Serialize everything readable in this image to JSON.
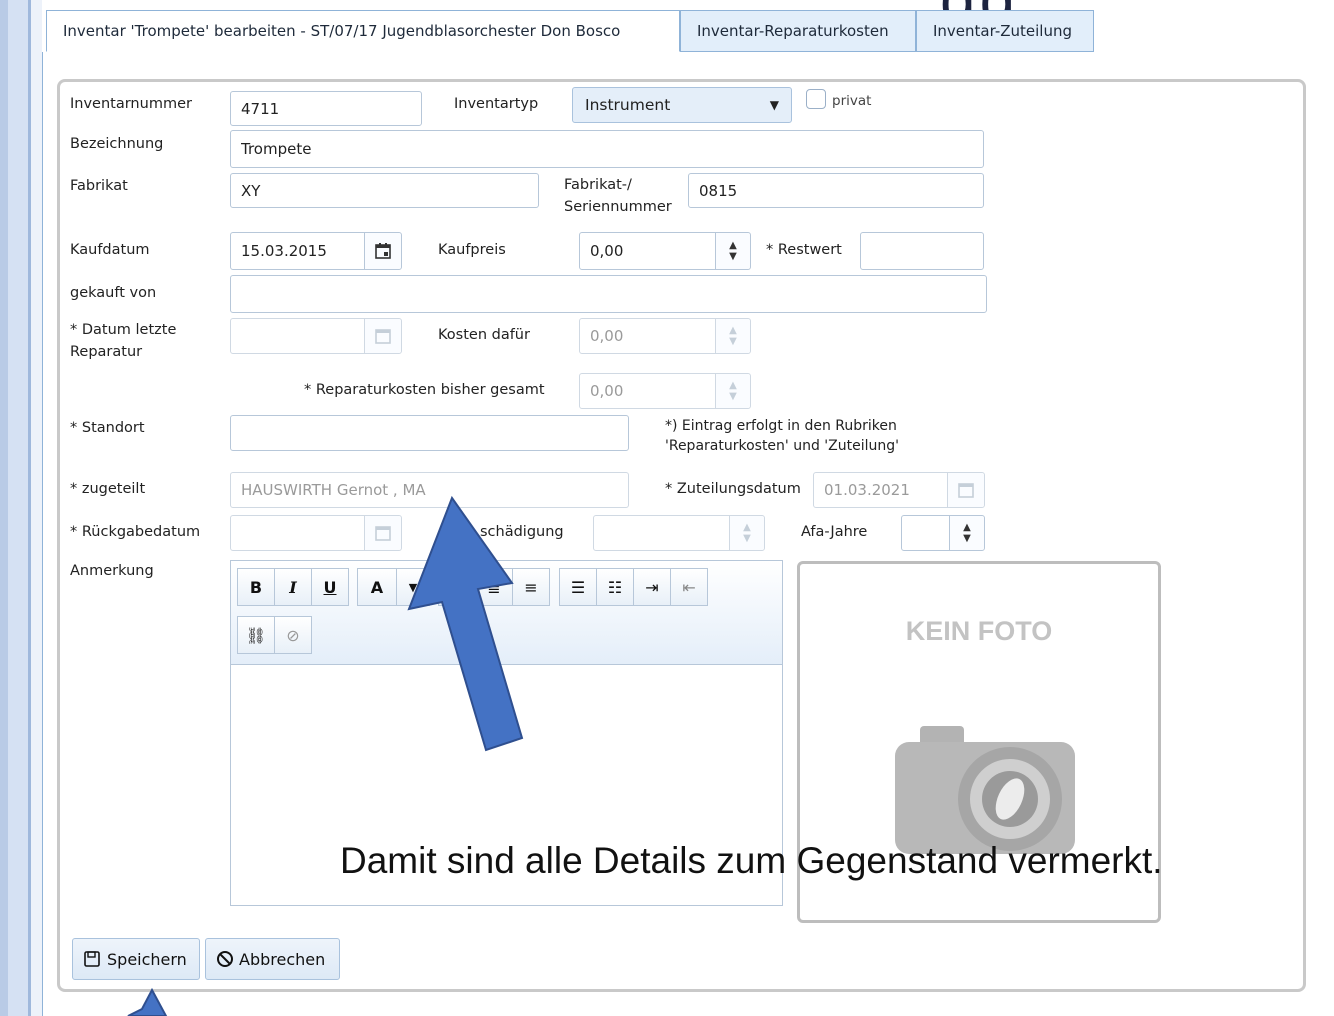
{
  "header_fragment": "gg",
  "tabs": [
    {
      "label": "Inventar 'Trompete' bearbeiten - ST/07/17 Jugendblasorchester Don Bosco",
      "active": true
    },
    {
      "label": "Inventar-Reparaturkosten",
      "active": false
    },
    {
      "label": "Inventar-Zuteilung",
      "active": false
    }
  ],
  "form": {
    "inventarnummer": {
      "label": "Inventarnummer",
      "value": "4711"
    },
    "inventartyp": {
      "label": "Inventartyp",
      "value": "Instrument"
    },
    "privat": {
      "label": "privat",
      "checked": false
    },
    "bezeichnung": {
      "label": "Bezeichnung",
      "value": "Trompete"
    },
    "fabrikat": {
      "label": "Fabrikat",
      "value": "XY"
    },
    "seriennummer": {
      "label_line1": "Fabrikat-/",
      "label_line2": "Seriennummer",
      "value": "0815"
    },
    "kaufdatum": {
      "label": "Kaufdatum",
      "value": "15.03.2015"
    },
    "kaufpreis": {
      "label": "Kaufpreis",
      "value": "0,00"
    },
    "restwert": {
      "label": "* Restwert",
      "value": ""
    },
    "gekauft_von": {
      "label": "gekauft von",
      "value": ""
    },
    "datum_letzte_reparatur": {
      "label_line1": "* Datum letzte",
      "label_line2": "Reparatur",
      "value": ""
    },
    "kosten_dafuer": {
      "label": "Kosten dafür",
      "value": "0,00"
    },
    "reparaturkosten_gesamt": {
      "label": "* Reparaturkosten bisher gesamt",
      "value": "0,00"
    },
    "standort": {
      "label": "* Standort",
      "value": ""
    },
    "hinweis": {
      "line1": "*) Eintrag erfolgt in den Rubriken",
      "line2": "'Reparaturkosten' und 'Zuteilung'"
    },
    "zugeteilt": {
      "label": "* zugeteilt",
      "value": "HAUSWIRTH Gernot , MA"
    },
    "zuteilungsdatum": {
      "label": "* Zuteilungsdatum",
      "value": "01.03.2021"
    },
    "rueckgabedatum": {
      "label": "* Rückgabedatum",
      "value": ""
    },
    "beschaedigung": {
      "label": "Beschädigung",
      "visible_label": "schädigung",
      "value": ""
    },
    "afa_jahre": {
      "label": "Afa-Jahre",
      "value": ""
    },
    "anmerkung": {
      "label": "Anmerkung",
      "value": ""
    }
  },
  "editor_toolbar": {
    "bold": "B",
    "italic": "I",
    "underline": "U",
    "font_color": "A"
  },
  "photo": {
    "placeholder_text": "KEIN FOTO"
  },
  "buttons": {
    "save": "Speichern",
    "cancel": "Abbrechen"
  },
  "caption": "Damit sind alle Details zum Gegenstand vermerkt.",
  "colors": {
    "accent_border": "#8fb3d8",
    "tab_background": "#e2eefa",
    "annotation_arrow": "#4472c4",
    "arrow_outline": "#2f4f8f"
  },
  "icons": [
    "calendar-icon",
    "spinner-icon",
    "dropdown-arrow-icon",
    "save-icon",
    "cancel-icon",
    "camera-icon",
    "link-icon",
    "unlink-icon",
    "align-center-icon",
    "align-right-icon",
    "bullet-list-icon",
    "numbered-list-icon",
    "indent-icon",
    "outdent-icon"
  ]
}
